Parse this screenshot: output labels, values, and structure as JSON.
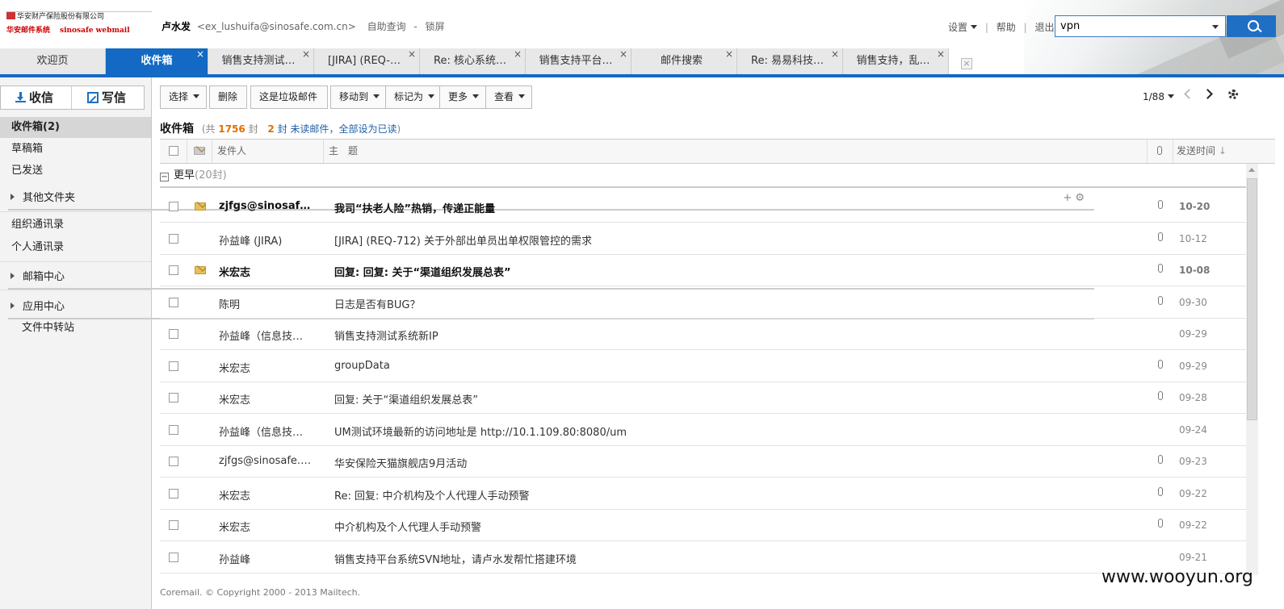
{
  "logo": {
    "company": "华安财产保险股份有限公司",
    "system": "华安邮件系统",
    "webmail": "sinosafe webmail"
  },
  "user": {
    "name": "卢水发",
    "email": "<ex_lushuifa@sinosafe.com.cn>",
    "link_query": "自助查询",
    "separator": "-",
    "link_lock": "锁屏"
  },
  "toplinks": {
    "settings": "设置",
    "help": "帮助",
    "logout": "退出"
  },
  "search": {
    "value": "vpn"
  },
  "tabs": [
    {
      "label": "欢迎页"
    },
    {
      "label": "收件箱",
      "close": "×"
    },
    {
      "label": "销售支持测试…",
      "close": "×"
    },
    {
      "label": "[JIRA] (REQ-…",
      "close": "×"
    },
    {
      "label": "Re: 核心系统…",
      "close": "×"
    },
    {
      "label": "销售支持平台…",
      "close": "×"
    },
    {
      "label": "邮件搜索",
      "close": "×"
    },
    {
      "label": "Re: 易易科技…",
      "close": "×"
    },
    {
      "label": "销售支持，乱…",
      "close": "×"
    }
  ],
  "tab_close_all": "×",
  "sidebar": {
    "receive": "收信",
    "compose": "写信",
    "inbox": "收件箱(2)",
    "drafts": "草稿箱",
    "sent": "已发送",
    "other_folders": "其他文件夹",
    "folder_tools": "+ ⚙",
    "org_contacts": "组织通讯录",
    "personal_contacts": "个人通讯录",
    "mailbox_center": "邮箱中心",
    "app_center": "应用中心",
    "file_transfer": "文件中转站"
  },
  "toolbar": {
    "select": "选择",
    "delete": "删除",
    "spam": "这是垃圾邮件",
    "move": "移动到",
    "mark": "标记为",
    "more": "更多",
    "view": "查看"
  },
  "pager": {
    "text": "1/88"
  },
  "folder": {
    "name": "收件箱",
    "total_prefix": "(共",
    "total": "1756",
    "total_suffix": "封",
    "unread": "2",
    "unread_text": "封 未读邮件",
    "mark_all": "，全部设为已读",
    "close": ")"
  },
  "columns": {
    "from": "发件人",
    "subject": "主　题",
    "date": "发送时间"
  },
  "group": {
    "toggle": "−",
    "label": "更早",
    "count": "(20封)"
  },
  "emails": [
    {
      "from": "zjfgs@sinosaf…",
      "subject": "我司“扶老人险”热销，传递正能量",
      "date": "10-20",
      "unread": true,
      "attach": true
    },
    {
      "from": "孙益峰 (JIRA)",
      "subject": "[JIRA] (REQ-712) 关于外部出单员出单权限管控的需求",
      "date": "10-12",
      "unread": false,
      "attach": true
    },
    {
      "from": "米宏志",
      "subject": "回复: 回复: 关于“渠道组织发展总表”",
      "date": "10-08",
      "unread": true,
      "attach": true
    },
    {
      "from": "陈明",
      "subject": "日志是否有BUG？",
      "date": "09-30",
      "unread": false,
      "attach": true
    },
    {
      "from": "孙益峰（信息技…",
      "subject": "销售支持测试系统新IP",
      "date": "09-29",
      "unread": false,
      "attach": false
    },
    {
      "from": "米宏志",
      "subject": "groupData",
      "date": "09-29",
      "unread": false,
      "attach": true
    },
    {
      "from": "米宏志",
      "subject": "回复: 关于“渠道组织发展总表”",
      "date": "09-28",
      "unread": false,
      "attach": true
    },
    {
      "from": "孙益峰（信息技…",
      "subject": "UM测试环境最新的访问地址是 http://10.1.109.80:8080/um",
      "date": "09-24",
      "unread": false,
      "attach": false
    },
    {
      "from": "zjfgs@sinosafe.c…",
      "subject": "华安保险天猫旗舰店9月活动",
      "date": "09-23",
      "unread": false,
      "attach": true
    },
    {
      "from": "米宏志",
      "subject": "Re: 回复: 中介机构及个人代理人手动预警",
      "date": "09-22",
      "unread": false,
      "attach": true
    },
    {
      "from": "米宏志",
      "subject": "中介机构及个人代理人手动预警",
      "date": "09-22",
      "unread": false,
      "attach": true
    },
    {
      "from": "孙益峰",
      "subject": "销售支持平台系统SVN地址，请卢水发帮忙搭建环境",
      "date": "09-21",
      "unread": false,
      "attach": false
    }
  ],
  "footer": "Coremail. © Copyright 2000 - 2013 Mailtech.",
  "watermark": "www.wooyun.org",
  "colors": {
    "accent": "#1369c3",
    "unread_count": "#e07000"
  }
}
